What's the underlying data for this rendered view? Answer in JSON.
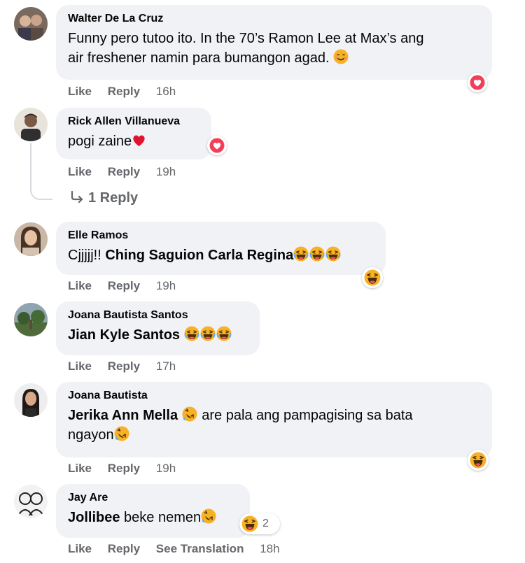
{
  "comments": [
    {
      "name": "Walter De La Cruz",
      "line1": "Funny pero tutoo ito. In the 70’s Ramon Lee at Max’s ang",
      "line2": "air freshener namin para bumangon agad.",
      "like": "Like",
      "reply": "Reply",
      "time": "16h"
    },
    {
      "name": "Rick Allen Villanueva",
      "text": "pogi zaine",
      "like": "Like",
      "reply": "Reply",
      "time": "19h",
      "replies_label": "1 Reply"
    },
    {
      "name": "Elle Ramos",
      "prefix": "Cjjjjj!! ",
      "tag": "Ching Saguion Carla Regina",
      "like": "Like",
      "reply": "Reply",
      "time": "19h"
    },
    {
      "name": "Joana Bautista Santos",
      "tag": "Jian Kyle Santos",
      "like": "Like",
      "reply": "Reply",
      "time": "17h"
    },
    {
      "name": "Joana Bautista",
      "tag": "Jerika Ann Mella",
      "rest": " are pala ang pampagising sa bata",
      "line2": "ngayon",
      "like": "Like",
      "reply": "Reply",
      "time": "19h"
    },
    {
      "name": "Jay Are",
      "tag": "Jollibee",
      "rest": " beke nemen",
      "reaction_count": "2",
      "like": "Like",
      "reply": "Reply",
      "see_translation": "See Translation",
      "time": "18h"
    }
  ],
  "colors": {
    "bubble": "#f0f2f5",
    "meta": "#65676b",
    "heart": "#f33e58",
    "emoji": "#f7b125"
  },
  "icons": [
    "heart-reaction-icon",
    "haha-reaction-icon",
    "smile-emoji-icon",
    "reply-arrow-icon"
  ]
}
